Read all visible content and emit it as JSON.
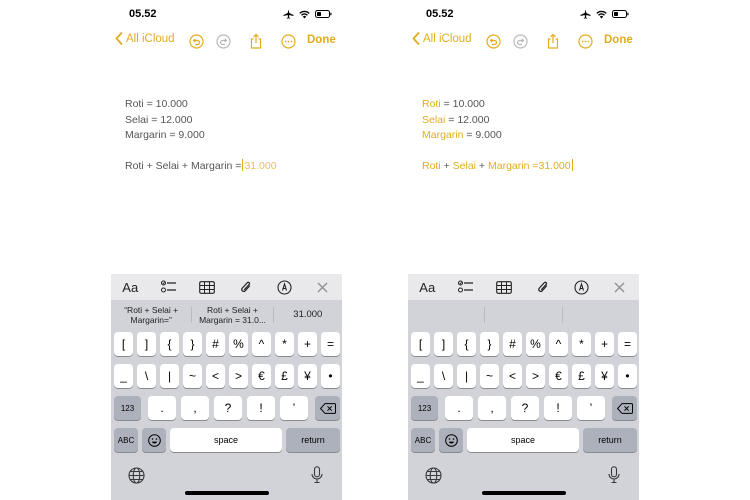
{
  "accent_color": "#e2ac1f",
  "status_bar": {
    "time": "05.52"
  },
  "nav": {
    "back_label": "All iCloud",
    "done_label": "Done"
  },
  "note_left": {
    "line1": "Roti = 10.000",
    "line2": "Selai = 12.000",
    "line3": "Margarin = 9.000",
    "expression": "Roti + Selai + Margarin =",
    "result": "31.000"
  },
  "note_right": {
    "line1_var": "Roti",
    "line1_rest": " = 10.000",
    "line2_var": "Selai",
    "line2_rest": " = 12.000",
    "line3_var": "Margarin",
    "line3_rest": " = 9.000",
    "expr_var1": "Roti",
    "expr_op1": " + ",
    "expr_var2": "Selai",
    "expr_op2": " + ",
    "expr_var3": "Margarin",
    "expr_eq": " =",
    "result": "31.000"
  },
  "toolbar": {
    "format_label": "Aa"
  },
  "suggestions_left": [
    "“Roti + Selai + Margarin=”",
    "Roti + Selai + Margarin = 31.0...",
    "31.000"
  ],
  "keys": {
    "row1": [
      "[",
      "]",
      "{",
      "}",
      "#",
      "%",
      "^",
      "*",
      "+",
      "="
    ],
    "row2": [
      "_",
      "\\",
      "|",
      "~",
      "<",
      ">",
      "€",
      "£",
      "¥",
      "•"
    ],
    "row3_toggle": "123",
    "row3": [
      ".",
      ",",
      "?",
      "!",
      "’"
    ],
    "abc": "ABC",
    "space": "space",
    "return": "return"
  },
  "icons": [
    "airplane-icon",
    "wifi-icon",
    "battery-icon",
    "chevron-left-icon",
    "undo-icon",
    "redo-icon",
    "share-icon",
    "more-icon",
    "checklist-icon",
    "table-icon",
    "attachment-icon",
    "markup-icon",
    "close-icon",
    "delete-icon",
    "emoji-icon",
    "globe-icon",
    "mic-icon"
  ]
}
